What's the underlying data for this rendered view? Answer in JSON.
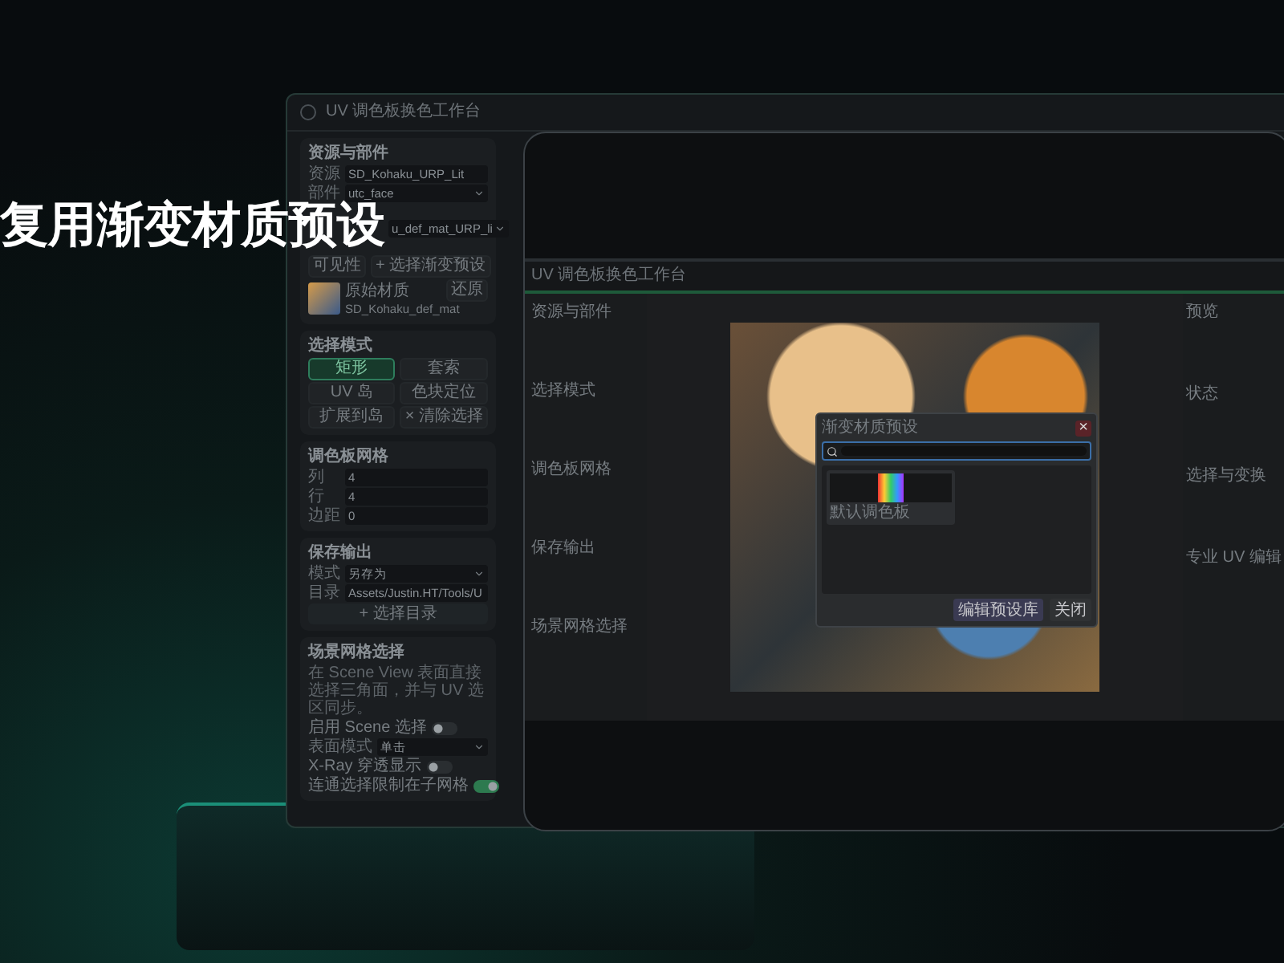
{
  "headline": "复用渐变材质预设",
  "back_window": {
    "title": "UV 调色板换色工作台",
    "sections": [
      {
        "title": "资源与部件",
        "items": [
          {
            "kind": "field",
            "label": "资源",
            "value": "SD_Kohaku_URP_Lit"
          },
          {
            "kind": "select",
            "label": "部件",
            "value": "utc_face"
          },
          {
            "kind": "partial",
            "value": "u_def_mat_URP_li"
          },
          {
            "kind": "actions",
            "buttons": [
              {
                "label": "可见性",
                "selected": false
              },
              {
                "label": "+ 选择渐变预设",
                "selected": false
              }
            ]
          },
          {
            "kind": "material",
            "title": "原始材质",
            "subtitle": "SD_Kohaku_def_mat",
            "button": "还原"
          }
        ]
      },
      {
        "title": "选择模式",
        "items": [
          {
            "kind": "grid",
            "buttons": [
              {
                "label": "矩形",
                "selected": true
              },
              {
                "label": "套索",
                "selected": false
              },
              {
                "label": "UV 岛",
                "selected": false
              },
              {
                "label": "色块定位",
                "selected": false
              },
              {
                "label": "扩展到岛",
                "selected": false
              },
              {
                "label": "× 清除选择",
                "selected": false
              }
            ]
          }
        ]
      },
      {
        "title": "调色板网格",
        "items": [
          {
            "kind": "field",
            "label": "列",
            "value": "4"
          },
          {
            "kind": "field",
            "label": "行",
            "value": "4"
          },
          {
            "kind": "field",
            "label": "边距",
            "value": "0"
          }
        ]
      },
      {
        "title": "保存输出",
        "items": [
          {
            "kind": "select",
            "label": "模式",
            "value": "另存为"
          },
          {
            "kind": "field",
            "label": "目录",
            "value": "Assets/Justin.HT/Tools/U"
          },
          {
            "kind": "action",
            "label": "+ 选择目录"
          }
        ]
      },
      {
        "title": "场景网格选择",
        "items": [
          {
            "kind": "text",
            "text": "在 Scene View 表面直接选择三角面，并与 UV 选区同步。"
          },
          {
            "kind": "toggle",
            "label": "启用 Scene 选择",
            "on": false
          },
          {
            "kind": "select",
            "label": "表面模式",
            "value": "单击"
          },
          {
            "kind": "toggle",
            "label": "X-Ray 穿透显示",
            "on": false
          },
          {
            "kind": "toggle",
            "label": "连通选择限制在子网格",
            "on": true
          }
        ]
      }
    ]
  },
  "front_window": {
    "title": "UV 调色板换色工作台",
    "sidebar": [
      "资源与部件",
      "选择模式",
      "调色板网格",
      "保存输出",
      "场景网格选择"
    ],
    "right_panel": [
      "预览",
      "状态",
      "选择与变换",
      "专业 UV 编辑"
    ],
    "dialog": {
      "title": "渐变材质预设",
      "close": "×",
      "presets": [
        {
          "name": "默认调色板"
        }
      ],
      "buttons": [
        "编辑预设库",
        "关闭"
      ]
    }
  }
}
